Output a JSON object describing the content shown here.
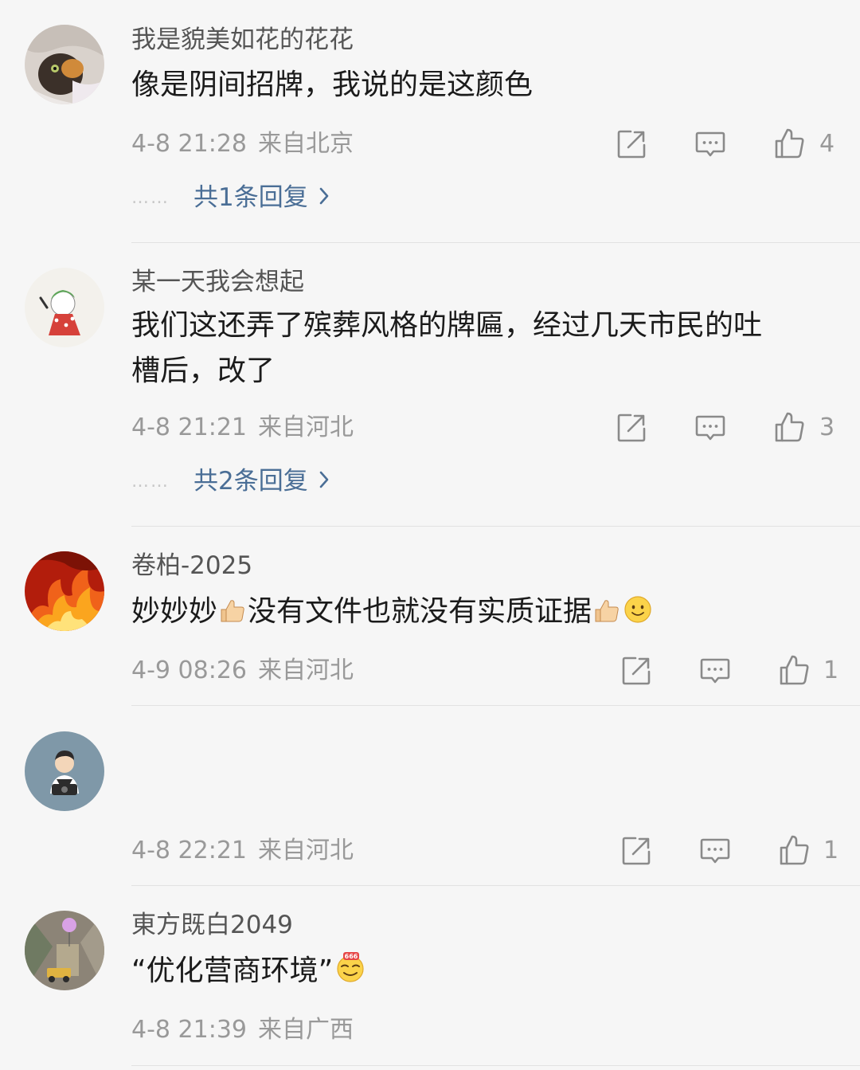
{
  "comments": [
    {
      "username": "我是貌美如花的花花",
      "text": "像是阴间招牌，我说的是这颜色",
      "time": "4-8 21:28",
      "location": "来自北京",
      "likes": "4",
      "replies": "共1条回复",
      "avatar_icon": "cat-photo"
    },
    {
      "username": "某一天我会想起",
      "text_line1": "我们这还弄了殡葬风格的牌匾，经过几天市民的吐",
      "text_line2": "槽后，改了",
      "time": "4-8 21:21",
      "location": "来自河北",
      "likes": "3",
      "replies": "共2条回复",
      "avatar_icon": "cartoon-character"
    },
    {
      "username": "卷柏-2025",
      "text_part1": "妙妙妙",
      "text_part2": "没有文件也就没有实质证据",
      "emojis": [
        "thumbs-up-emoji",
        "thumbs-up-emoji",
        "smile-emoji"
      ],
      "time": "4-9 08:26",
      "location": "来自河北",
      "likes": "1",
      "avatar_icon": "fire-photo"
    },
    {
      "username": "",
      "text": "",
      "time": "4-8 22:21",
      "location": "来自河北",
      "likes": "1",
      "avatar_icon": "person-with-camera"
    },
    {
      "username": "東方既白2049",
      "text": "“优化营商环境”",
      "emojis": [
        "666-emoji"
      ],
      "time": "4-8 21:39",
      "location": "来自广西",
      "avatar_icon": "balloon-street-photo"
    }
  ],
  "icons": {
    "share": "share-icon",
    "comment": "comment-icon",
    "like": "thumbs-up-icon",
    "reply_chevron": "chevron-right-icon"
  },
  "colors": {
    "background": "#f6f6f6",
    "text": "#1b1b1b",
    "username": "#555555",
    "meta": "#999999",
    "reply_link": "#4a6e96"
  }
}
